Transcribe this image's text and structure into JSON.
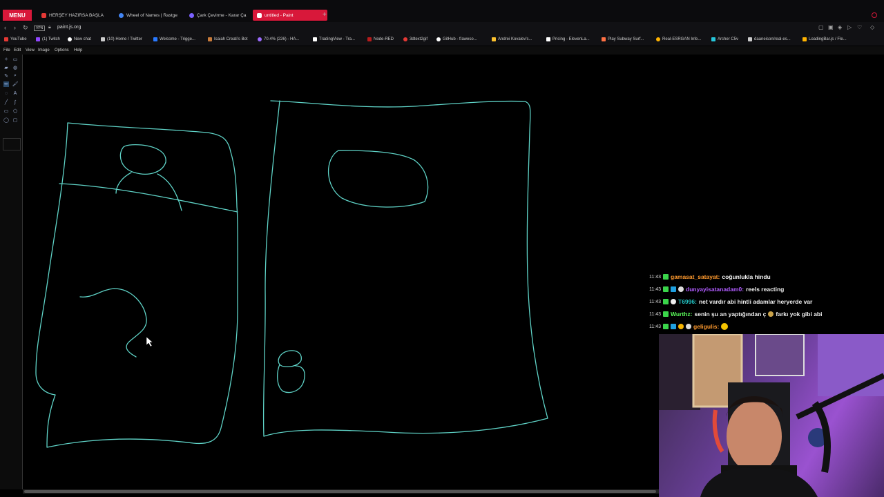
{
  "browser": {
    "menu_label": "MENU",
    "tabs": [
      {
        "label": "HERŞEY HAZIRSA BAŞLA",
        "color": "#e53935"
      },
      {
        "label": "Wheel of Names | Rastge",
        "color": "#4285f4"
      },
      {
        "label": "Çark Çevirme - Karar Ça",
        "color": "#7b61ff"
      },
      {
        "label": "untitled - Paint",
        "color": "#ffffff",
        "active": true
      }
    ],
    "address": "paint.js.org",
    "vpn_label": "VPN",
    "bookmarks": [
      {
        "label": "YouTube",
        "color": "#e53935"
      },
      {
        "label": "(1) Twitch",
        "color": "#9146ff"
      },
      {
        "label": "New chat",
        "color": "#ffffff"
      },
      {
        "label": "(10) Home / Twitter",
        "color": "#cccccc"
      },
      {
        "label": "Welcome - Trigge...",
        "color": "#2979ff"
      },
      {
        "label": "Isaiah Creati's Bot",
        "color": "#c97b3a"
      },
      {
        "label": "70.4% (226) - HA...",
        "color": "#9c6bff"
      },
      {
        "label": "TradingView - Tra...",
        "color": "#ffffff"
      },
      {
        "label": "Node-RED",
        "color": "#b71c1c"
      },
      {
        "label": "3dtext2gif",
        "color": "#e53935"
      },
      {
        "label": "GitHub - f/aweso...",
        "color": "#ffffff"
      },
      {
        "label": "Andrei Kovalev's...",
        "color": "#fbc02d"
      },
      {
        "label": "Pricing - ElevenLa...",
        "color": "#ffffff"
      },
      {
        "label": "Play Subway Surf...",
        "color": "#ff7043"
      },
      {
        "label": "Real-ESRGAN Infe...",
        "color": "#ffb300"
      },
      {
        "label": "Archer C5v",
        "color": "#26c6da"
      },
      {
        "label": "daaneison/real-es...",
        "color": "#cccccc"
      },
      {
        "label": "LoadingBar.js / Fle...",
        "color": "#ffb300"
      }
    ]
  },
  "paint": {
    "menu": [
      "File",
      "Edit",
      "View",
      "Image",
      "Options",
      "Help"
    ],
    "stroke_color": "#5fd3c7"
  },
  "chat": [
    {
      "time": "11:43",
      "user": "gamasat_satayat:",
      "msg": "coğunlukla hindu",
      "color": "#ff9a2e"
    },
    {
      "time": "11:43",
      "user": "dunyayisatanadam0:",
      "msg": "reels reacting",
      "color": "#b05cff"
    },
    {
      "time": "11:43",
      "user": "T6996:",
      "msg": "net vardır abi hintli adamlar heryerde var",
      "color": "#22c4c4"
    },
    {
      "time": "11:43",
      "user": "Wurthz:",
      "msg": "senin şu an yaptığından ç",
      "msg2": "farkı yok gibi abi",
      "color": "#5cff5c"
    },
    {
      "time": "11:43",
      "user": "geligulis:",
      "msg": "",
      "color": "#ff9a2e"
    }
  ]
}
